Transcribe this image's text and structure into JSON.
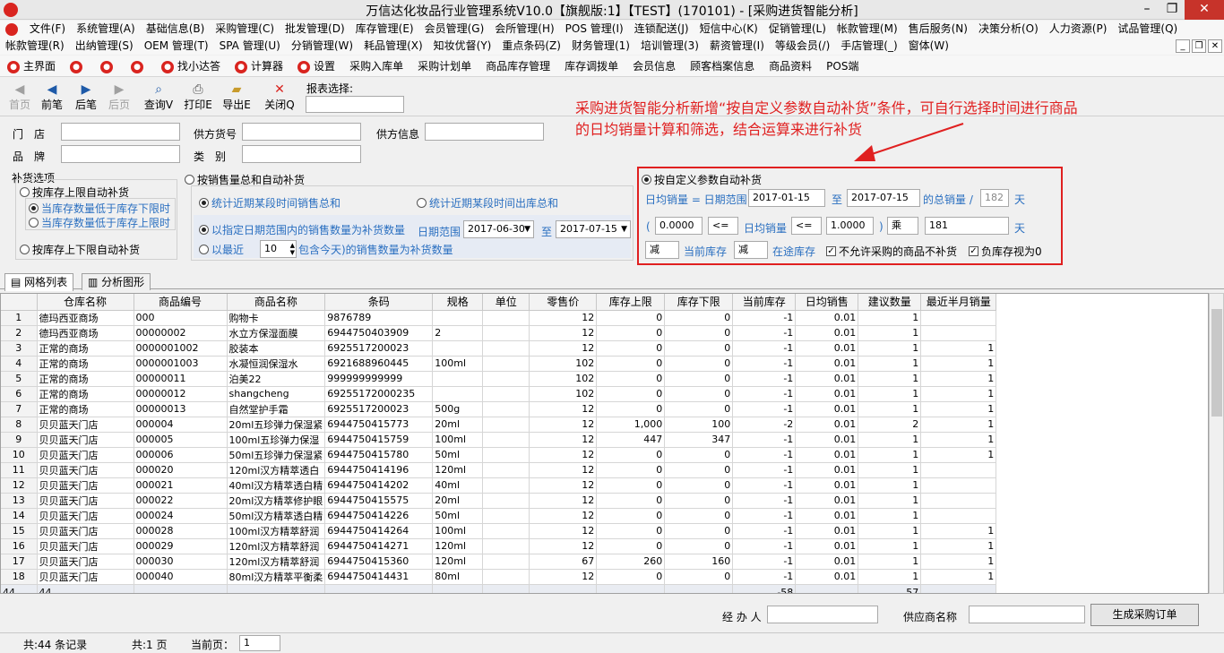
{
  "window": {
    "title": "万信达化妆品行业管理系统V10.0【旗舰版:1】【TEST】(170101) - [采购进货智能分析]"
  },
  "menu_row1": [
    "文件(F)",
    "系统管理(A)",
    "基础信息(B)",
    "采购管理(C)",
    "批发管理(D)",
    "库存管理(E)",
    "会员管理(G)",
    "会所管理(H)",
    "POS 管理(I)",
    "连锁配送(J)",
    "短信中心(K)",
    "促销管理(L)",
    "帐款管理(M)",
    "售后服务(N)",
    "决策分析(O)",
    "人力资源(P)",
    "试品管理(Q)"
  ],
  "menu_row2": [
    "帐款管理(R)",
    "出纳管理(S)",
    "OEM 管理(T)",
    "SPA 管理(U)",
    "分销管理(W)",
    "耗品管理(X)",
    "知妆优督(Y)",
    "重点条码(Z)",
    "财务管理(1)",
    "培训管理(3)",
    "薪资管理(I)",
    "等级会员(/)",
    "手店管理(_)",
    "窗体(W)"
  ],
  "shortcuts": [
    "主界面",
    "找小达答",
    "计算器",
    "设置",
    "采购入库单",
    "采购计划单",
    "商品库存管理",
    "库存调拨单",
    "会员信息",
    "顾客档案信息",
    "商品资料",
    "POS端"
  ],
  "toolbar": {
    "first": "首页",
    "prev": "前笔",
    "next": "后笔",
    "last": "后页",
    "query": "查询V",
    "print": "打印E",
    "export": "导出E",
    "close": "关闭Q",
    "report_label": "报表选择:"
  },
  "annotation": {
    "line1": "采购进货智能分析新增“按自定义参数自动补货”条件，可自行选择时间进行商品",
    "line2": "的日均销量计算和筛选，结合运算来进行补货"
  },
  "filters": {
    "store_label": "门　店",
    "brand_label": "品　牌",
    "supplier_no_label": "供方货号",
    "category_label": "类　别",
    "supplier_info_label": "供方信息"
  },
  "replenish": {
    "group_title": "补货选项",
    "by_upper": "按库存上限自动补货",
    "below_lower": "当库存数量低于库存下限时",
    "below_upper": "当库存数量低于库存上限时",
    "by_upper_lower": "按库存上下限自动补货",
    "by_sales": "按销售量总和自动补货",
    "recent_sales_total": "统计近期某段时间销售总和",
    "recent_out_total": "统计近期某段时间出库总和",
    "date_range_sales": "以指定日期范围内的销售数量为补货数量",
    "date_range_label": "日期范围",
    "date_from": "2017-06-30",
    "to": "至",
    "date_to": "2017-07-15",
    "recent_label": "以最近",
    "recent_days": "10",
    "recent_suffix": "包含今天)的销售数量为补货数量"
  },
  "custom": {
    "title": "按自定义参数自动补货",
    "formula_label": "日均销量 = 日期范围",
    "date_from": "2017-01-15",
    "to": "至",
    "date_to": "2017-07-15",
    "total_label": "的总销量 /",
    "days": "182",
    "days_unit": "天",
    "lower": "0.0000",
    "op1": "<=",
    "avg_label": "日均销量",
    "op2": "<=",
    "upper": "1.0000",
    "paren_l": "(",
    "paren_r": ")",
    "mul": "乘",
    "mul_days": "181",
    "mul_unit": "天",
    "minus1": "减",
    "current_stock": "当前库存",
    "minus2": "减",
    "in_transit": "在途库存",
    "no_purchase": "不允许采购的商品不补货",
    "negative_zero": "负库存视为0"
  },
  "tabs": [
    "网格列表",
    "分析图形"
  ],
  "grid": {
    "columns": [
      "",
      "仓库名称",
      "商品编号",
      "商品名称",
      "条码",
      "规格",
      "单位",
      "零售价",
      "库存上限",
      "库存下限",
      "当前库存",
      "日均销售",
      "建议数量",
      "最近半月销量"
    ],
    "rows": [
      [
        "1",
        "德玛西亚商场",
        "000",
        "购物卡",
        "9876789",
        "",
        "",
        "12",
        "0",
        "0",
        "-1",
        "0.01",
        "1",
        ""
      ],
      [
        "2",
        "德玛西亚商场",
        "00000002",
        "水立方保湿面膜",
        "6944750403909",
        "2",
        "",
        "12",
        "0",
        "0",
        "-1",
        "0.01",
        "1",
        ""
      ],
      [
        "3",
        "正常的商场",
        "0000001002",
        "胶装本",
        "6925517200023",
        "",
        "",
        "12",
        "0",
        "0",
        "-1",
        "0.01",
        "1",
        "1"
      ],
      [
        "4",
        "正常的商场",
        "0000001003",
        "水凝恒润保湿水",
        "6921688960445",
        "100ml",
        "",
        "102",
        "0",
        "0",
        "-1",
        "0.01",
        "1",
        "1"
      ],
      [
        "5",
        "正常的商场",
        "00000011",
        "泊美22",
        "999999999999",
        "",
        "",
        "102",
        "0",
        "0",
        "-1",
        "0.01",
        "1",
        "1"
      ],
      [
        "6",
        "正常的商场",
        "00000012",
        "shangcheng",
        "69255172000235",
        "",
        "",
        "102",
        "0",
        "0",
        "-1",
        "0.01",
        "1",
        "1"
      ],
      [
        "7",
        "正常的商场",
        "00000013",
        "自然堂护手霜",
        "6925517200023",
        "500g",
        "",
        "12",
        "0",
        "0",
        "-1",
        "0.01",
        "1",
        "1"
      ],
      [
        "8",
        "贝贝蓝天门店",
        "000004",
        "20ml五珍弹力保湿紧",
        "6944750415773",
        "20ml",
        "",
        "12",
        "1,000",
        "100",
        "-2",
        "0.01",
        "2",
        "1"
      ],
      [
        "9",
        "贝贝蓝天门店",
        "000005",
        "100ml五珍弹力保湿",
        "6944750415759",
        "100ml",
        "",
        "12",
        "447",
        "347",
        "-1",
        "0.01",
        "1",
        "1"
      ],
      [
        "10",
        "贝贝蓝天门店",
        "000006",
        "50ml五珍弹力保湿紧",
        "6944750415780",
        "50ml",
        "",
        "12",
        "0",
        "0",
        "-1",
        "0.01",
        "1",
        "1"
      ],
      [
        "11",
        "贝贝蓝天门店",
        "000020",
        "120ml汉方精萃透白",
        "6944750414196",
        "120ml",
        "",
        "12",
        "0",
        "0",
        "-1",
        "0.01",
        "1",
        ""
      ],
      [
        "12",
        "贝贝蓝天门店",
        "000021",
        "40ml汉方精萃透白精",
        "6944750414202",
        "40ml",
        "",
        "12",
        "0",
        "0",
        "-1",
        "0.01",
        "1",
        ""
      ],
      [
        "13",
        "贝贝蓝天门店",
        "000022",
        "20ml汉方精萃修护眼",
        "6944750415575",
        "20ml",
        "",
        "12",
        "0",
        "0",
        "-1",
        "0.01",
        "1",
        ""
      ],
      [
        "14",
        "贝贝蓝天门店",
        "000024",
        "50ml汉方精萃透白精",
        "6944750414226",
        "50ml",
        "",
        "12",
        "0",
        "0",
        "-1",
        "0.01",
        "1",
        ""
      ],
      [
        "15",
        "贝贝蓝天门店",
        "000028",
        "100ml汉方精萃舒润",
        "6944750414264",
        "100ml",
        "",
        "12",
        "0",
        "0",
        "-1",
        "0.01",
        "1",
        "1"
      ],
      [
        "16",
        "贝贝蓝天门店",
        "000029",
        "120ml汉方精萃舒润",
        "6944750414271",
        "120ml",
        "",
        "12",
        "0",
        "0",
        "-1",
        "0.01",
        "1",
        "1"
      ],
      [
        "17",
        "贝贝蓝天门店",
        "000030",
        "120ml汉方精萃舒润",
        "6944750415360",
        "120ml",
        "",
        "67",
        "260",
        "160",
        "-1",
        "0.01",
        "1",
        "1"
      ],
      [
        "18",
        "贝贝蓝天门店",
        "000040",
        "80ml汉方精萃平衡柔",
        "6944750414431",
        "80ml",
        "",
        "12",
        "0",
        "0",
        "-1",
        "0.01",
        "1",
        "1"
      ]
    ],
    "summary": [
      "44",
      "44",
      "",
      "",
      "",
      "",
      "",
      "",
      "",
      "",
      "-58",
      "",
      "57",
      ""
    ]
  },
  "bottom": {
    "handler_label": "经 办 人",
    "supplier_label": "供应商名称",
    "order_button": "生成采购订单"
  },
  "status": {
    "records": "共:44 条记录",
    "pages": "共:1 页",
    "current_label": "当前页：",
    "current_page": "1"
  }
}
